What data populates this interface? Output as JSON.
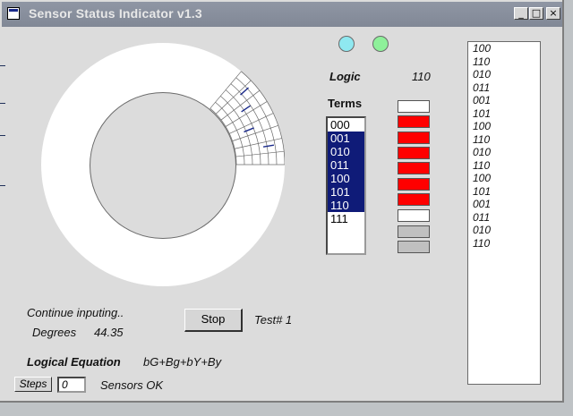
{
  "window": {
    "title": "Sensor Status Indicator v1.3",
    "controls": {
      "minimize": "_",
      "maximize": "□",
      "close": "×"
    }
  },
  "indicators": {
    "led_left_color": "#8fe8f0",
    "led_right_color": "#8ef09a"
  },
  "logic": {
    "label": "Logic",
    "value": "110"
  },
  "terms": {
    "label": "Terms",
    "items": [
      {
        "text": "000",
        "selected": false,
        "indicator": "#ffffff"
      },
      {
        "text": "001",
        "selected": true,
        "indicator": "#ff0000"
      },
      {
        "text": "010",
        "selected": true,
        "indicator": "#ff0000"
      },
      {
        "text": "011",
        "selected": true,
        "indicator": "#ff0000"
      },
      {
        "text": "100",
        "selected": true,
        "indicator": "#ff0000"
      },
      {
        "text": "101",
        "selected": true,
        "indicator": "#ff0000"
      },
      {
        "text": "110",
        "selected": true,
        "indicator": "#ff0000"
      },
      {
        "text": "111",
        "selected": false,
        "indicator": "#ffffff"
      }
    ],
    "extra_indicators": [
      "#c0c0c0",
      "#c0c0c0"
    ]
  },
  "history": [
    "100",
    "110",
    "010",
    "011",
    "001",
    "101",
    "100",
    "110",
    "010",
    "110",
    "100",
    "101",
    "001",
    "011",
    "010",
    "110"
  ],
  "status": {
    "message": "Continue inputing..",
    "degrees_label": "Degrees",
    "degrees_value": "44.35",
    "stop_label": "Stop",
    "test_label": "Test#  1"
  },
  "equation": {
    "label": "Logical Equation",
    "value": "bG+Bg+bY+By"
  },
  "steps": {
    "label": "Steps",
    "value": "0",
    "sensors": "Sensors OK"
  }
}
